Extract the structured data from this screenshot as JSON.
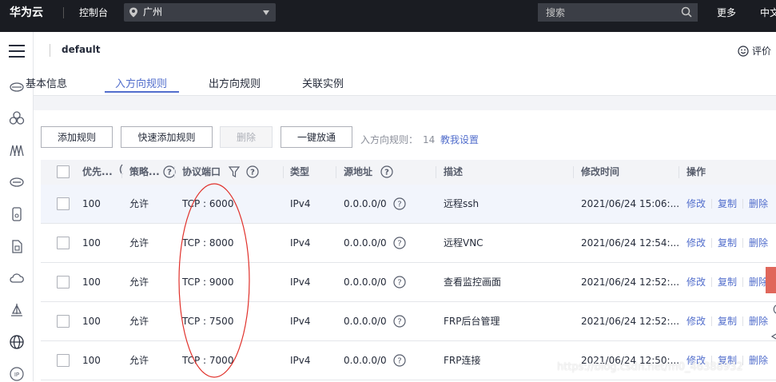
{
  "topbar": {
    "logo": "华为云",
    "console": "控制台",
    "region": "广州",
    "search_placeholder": "搜索",
    "more": "更多",
    "lang": "中文"
  },
  "header": {
    "title": "default",
    "rate": "评价"
  },
  "tabs": [
    "基本信息",
    "入方向规则",
    "出方向规则",
    "关联实例"
  ],
  "toolbar": {
    "add_rule": "添加规则",
    "quick_add": "快速添加规则",
    "delete": "删除",
    "one_click": "一键放通",
    "rule_count_label": "入方向规则：",
    "rule_count": "14",
    "teach_link": "教我设置"
  },
  "table": {
    "columns": [
      "优先...",
      "策略...",
      "协议端口",
      "类型",
      "源地址",
      "描述",
      "修改时间",
      "操作"
    ],
    "rows": [
      {
        "priority": "100",
        "policy": "允许",
        "port": "TCP : 6000",
        "type": "IPv4",
        "source": "0.0.0.0/0",
        "desc": "远程ssh",
        "time": "2021/06/24 15:06:..."
      },
      {
        "priority": "100",
        "policy": "允许",
        "port": "TCP : 8000",
        "type": "IPv4",
        "source": "0.0.0.0/0",
        "desc": "远程VNC",
        "time": "2021/06/24 12:54:..."
      },
      {
        "priority": "100",
        "policy": "允许",
        "port": "TCP : 9000",
        "type": "IPv4",
        "source": "0.0.0.0/0",
        "desc": "查看监控画面",
        "time": "2021/06/24 12:52:..."
      },
      {
        "priority": "100",
        "policy": "允许",
        "port": "TCP : 7500",
        "type": "IPv4",
        "source": "0.0.0.0/0",
        "desc": "FRP后台管理",
        "time": "2021/06/24 12:52:..."
      },
      {
        "priority": "100",
        "policy": "允许",
        "port": "TCP : 7000",
        "type": "IPv4",
        "source": "0.0.0.0/0",
        "desc": "FRP连接",
        "time": "2021/06/24 12:50:..."
      }
    ],
    "actions": {
      "modify": "修改",
      "copy": "复制",
      "delete": "删除"
    }
  },
  "watermark": "https://blog.csdn.net/m0_46388932",
  "colors": {
    "accent": "#526ecc",
    "topbar": "#1a1c22",
    "annotation": "#e0302a"
  }
}
